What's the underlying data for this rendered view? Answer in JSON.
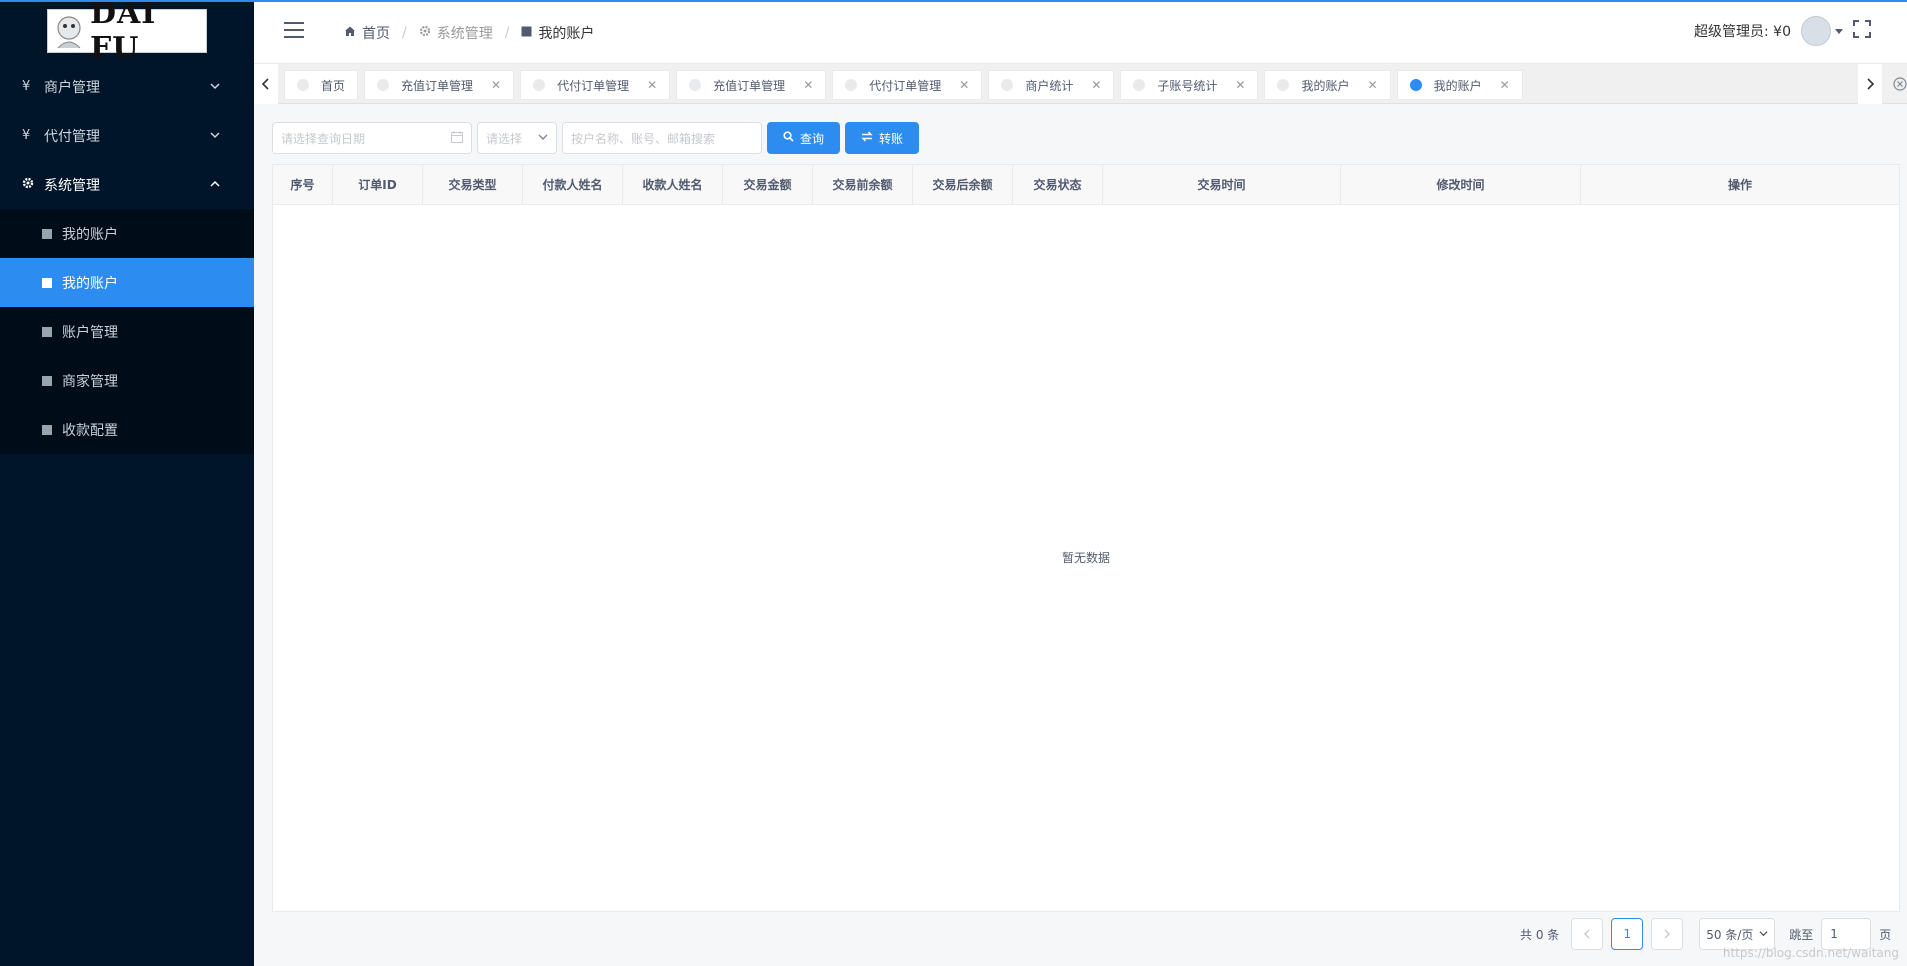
{
  "sidebar": {
    "logo_text": "DAI FU",
    "groups": [
      {
        "icon": "yen-icon",
        "label": "商户管理"
      },
      {
        "icon": "yen-icon",
        "label": "代付管理"
      },
      {
        "icon": "gear-icon",
        "label": "系统管理"
      }
    ],
    "sub_items": [
      {
        "label": "我的账户"
      },
      {
        "label": "我的账户"
      },
      {
        "label": "账户管理"
      },
      {
        "label": "商家管理"
      },
      {
        "label": "收款配置"
      }
    ]
  },
  "header": {
    "breadcrumb": [
      "首页",
      "系统管理",
      "我的账户"
    ],
    "user_label": "超级管理员: ¥0"
  },
  "tabs": [
    {
      "label": "首页",
      "closable": false
    },
    {
      "label": "充值订单管理",
      "closable": true
    },
    {
      "label": "代付订单管理",
      "closable": true
    },
    {
      "label": "充值订单管理",
      "closable": true
    },
    {
      "label": "代付订单管理",
      "closable": true
    },
    {
      "label": "商户统计",
      "closable": true
    },
    {
      "label": "子账号统计",
      "closable": true
    },
    {
      "label": "我的账户",
      "closable": true
    },
    {
      "label": "我的账户",
      "closable": true,
      "active": true
    }
  ],
  "toolbar": {
    "date_placeholder": "请选择查询日期",
    "select_placeholder": "请选择",
    "search_placeholder": "按户名称、账号、邮箱搜索",
    "query_label": "查询",
    "transfer_label": "转账"
  },
  "table": {
    "columns": [
      "序号",
      "订单ID",
      "交易类型",
      "付款人姓名",
      "收款人姓名",
      "交易金额",
      "交易前余额",
      "交易后余额",
      "交易状态",
      "交易时间",
      "修改时间",
      "操作"
    ],
    "empty_text": "暂无数据"
  },
  "pagination": {
    "total_text": "共 0 条",
    "current_page": "1",
    "page_size": "50 条/页",
    "jump_label": "跳至",
    "jump_value": "1",
    "page_suffix": "页"
  },
  "watermark": "https://blog.csdn.net/waitang",
  "colors": {
    "accent": "#2d8cf0",
    "sidebar_bg": "#001529",
    "submenu_bg": "#000c17"
  }
}
